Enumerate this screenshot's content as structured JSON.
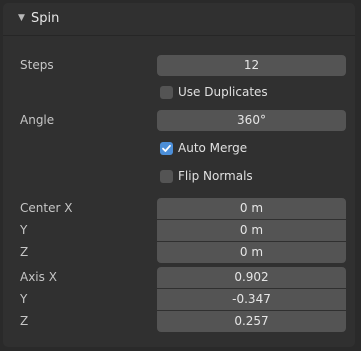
{
  "panel": {
    "title": "Spin",
    "steps_label": "Steps",
    "steps_value": "12",
    "use_duplicates_label": "Use Duplicates",
    "use_duplicates_checked": false,
    "angle_label": "Angle",
    "angle_value": "360°",
    "auto_merge_label": "Auto Merge",
    "auto_merge_checked": true,
    "flip_normals_label": "Flip Normals",
    "flip_normals_checked": false,
    "center": {
      "x_label": "Center X",
      "x_value": "0 m",
      "y_label": "Y",
      "y_value": "0 m",
      "z_label": "Z",
      "z_value": "0 m"
    },
    "axis": {
      "x_label": "Axis X",
      "x_value": "0.902",
      "y_label": "Y",
      "y_value": "-0.347",
      "z_label": "Z",
      "z_value": "0.257"
    }
  },
  "colors": {
    "background": "#2a2a2a",
    "panel": "#303030",
    "field": "#545454",
    "accent": "#4c8fd9",
    "text": "#e6e6e6"
  },
  "icons": {
    "collapse": "disclosure-triangle-down",
    "check": "checkmark"
  }
}
